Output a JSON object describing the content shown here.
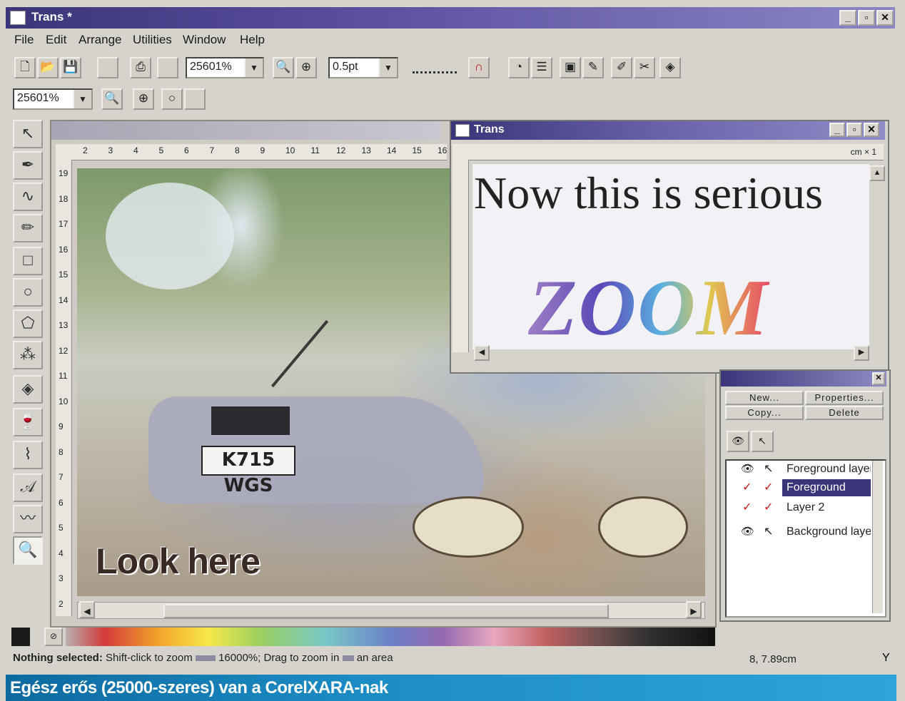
{
  "window": {
    "title": "Trans *",
    "min": "_",
    "max": "▫",
    "close": "✕"
  },
  "menu": [
    "File",
    "Edit",
    "Arrange",
    "Utilities",
    "Window",
    "Help"
  ],
  "toolbar": {
    "zoom_value": "25601%",
    "line_width": "0.5pt",
    "zoom_value_2": "25601%"
  },
  "ruler_top": [
    "2",
    "3",
    "4",
    "5",
    "6",
    "7",
    "8",
    "9",
    "10",
    "11",
    "12",
    "13",
    "14",
    "15",
    "16"
  ],
  "ruler_left": [
    "19",
    "18",
    "17",
    "16",
    "15",
    "14",
    "13",
    "12",
    "11",
    "10",
    "9",
    "8",
    "7",
    "6",
    "5",
    "4",
    "3",
    "2"
  ],
  "document": {
    "caption": "Look here",
    "plate": "K715 WGS"
  },
  "window2": {
    "title": "Trans",
    "ruler_unit": "cm × 1",
    "headline": "Now this is serious",
    "word": "ZOOM"
  },
  "layers": {
    "buttons": [
      "New...",
      "Properties...",
      "Copy...",
      "Delete"
    ],
    "items": [
      {
        "name": "Foreground layer",
        "selected": false
      },
      {
        "name": "Foreground",
        "selected": true
      },
      {
        "name": "Layer 2",
        "selected": false
      },
      {
        "name": "Background layer",
        "selected": false
      }
    ]
  },
  "status": {
    "label": "Nothing selected:",
    "text": "Shift-click to zoom",
    "text2": "16000%; Drag to zoom in",
    "text3": "an area",
    "coords": "8, 7.89cm"
  },
  "caption": {
    "text": "Egész erős (25000-szeres) van a CorelXARA-nak"
  },
  "colors": {
    "title_dark": "#3a3578",
    "caption_blue": "#1c8cc4",
    "select_blue": "#3a3578"
  }
}
